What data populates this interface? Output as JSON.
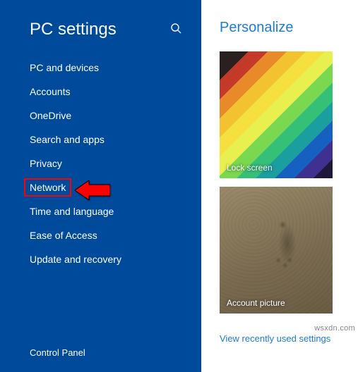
{
  "sidebar": {
    "title": "PC settings",
    "items": [
      {
        "label": "PC and devices"
      },
      {
        "label": "Accounts"
      },
      {
        "label": "OneDrive"
      },
      {
        "label": "Search and apps"
      },
      {
        "label": "Privacy"
      },
      {
        "label": "Network"
      },
      {
        "label": "Time and language"
      },
      {
        "label": "Ease of Access"
      },
      {
        "label": "Update and recovery"
      }
    ],
    "footer": "Control Panel"
  },
  "content": {
    "title": "Personalize",
    "tiles": {
      "lock_screen": "Lock screen",
      "account_picture": "Account picture"
    },
    "recent_link": "View recently used settings"
  },
  "watermark": "wsxdn.com"
}
